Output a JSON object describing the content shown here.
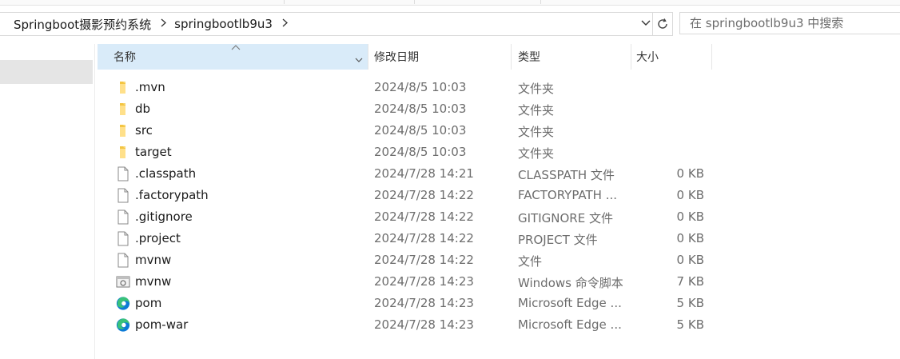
{
  "breadcrumb": [
    "Springboot摄影预约系统",
    "springbootlb9u3"
  ],
  "search": {
    "placeholder": "在 springbootlb9u3 中搜索"
  },
  "columns": {
    "name": "名称",
    "date": "修改日期",
    "type": "类型",
    "size": "大小"
  },
  "files": [
    {
      "name": ".mvn",
      "date": "2024/8/5 10:03",
      "type": "文件夹",
      "size": "",
      "icon": "folder-icon"
    },
    {
      "name": "db",
      "date": "2024/8/5 10:03",
      "type": "文件夹",
      "size": "",
      "icon": "folder-icon"
    },
    {
      "name": "src",
      "date": "2024/8/5 10:03",
      "type": "文件夹",
      "size": "",
      "icon": "folder-icon"
    },
    {
      "name": "target",
      "date": "2024/8/5 10:03",
      "type": "文件夹",
      "size": "",
      "icon": "folder-icon"
    },
    {
      "name": ".classpath",
      "date": "2024/7/28 14:21",
      "type": "CLASSPATH 文件",
      "size": "0 KB",
      "icon": "file-icon"
    },
    {
      "name": ".factorypath",
      "date": "2024/7/28 14:22",
      "type": "FACTORYPATH ...",
      "size": "0 KB",
      "icon": "file-icon"
    },
    {
      "name": ".gitignore",
      "date": "2024/7/28 14:22",
      "type": "GITIGNORE 文件",
      "size": "0 KB",
      "icon": "file-icon"
    },
    {
      "name": ".project",
      "date": "2024/7/28 14:22",
      "type": "PROJECT 文件",
      "size": "0 KB",
      "icon": "file-icon"
    },
    {
      "name": "mvnw",
      "date": "2024/7/28 14:22",
      "type": "文件",
      "size": "0 KB",
      "icon": "file-icon"
    },
    {
      "name": "mvnw",
      "date": "2024/7/28 14:23",
      "type": "Windows 命令脚本",
      "size": "7 KB",
      "icon": "cmd-script-icon"
    },
    {
      "name": "pom",
      "date": "2024/7/28 14:23",
      "type": "Microsoft Edge ...",
      "size": "5 KB",
      "icon": "edge-icon"
    },
    {
      "name": "pom-war",
      "date": "2024/7/28 14:23",
      "type": "Microsoft Edge ...",
      "size": "5 KB",
      "icon": "edge-icon"
    }
  ]
}
